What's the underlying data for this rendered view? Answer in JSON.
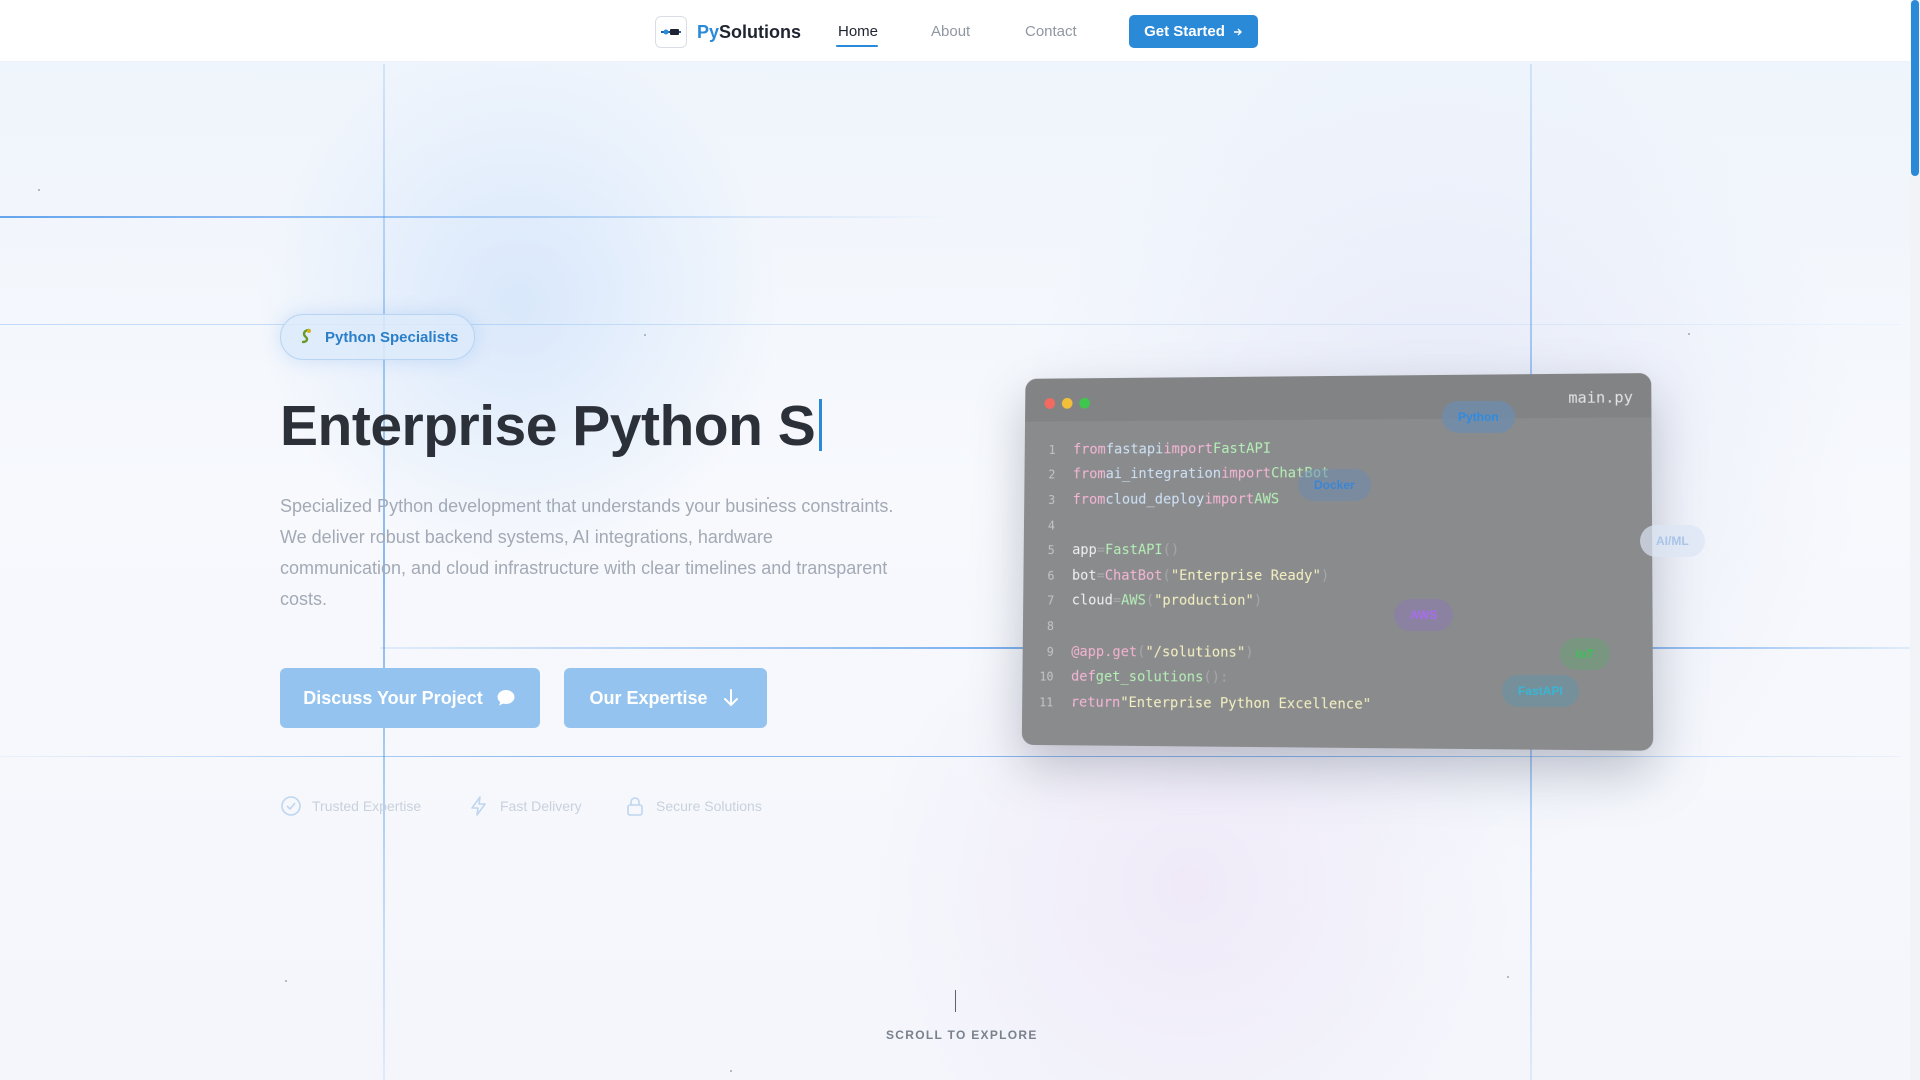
{
  "nav": {
    "brand_prefix": "Py",
    "brand_suffix": "Solutions",
    "links": [
      "Home",
      "About",
      "Contact"
    ],
    "cta_label": "Get Started"
  },
  "hero": {
    "badge": "Python Specialists",
    "title": "Enterprise Python S",
    "description": "Specialized Python development that understands your business constraints. We deliver robust backend systems, AI integrations, hardware communication, and cloud infrastructure with clear timelines and transparent costs.",
    "primary_button": "Discuss Your Project",
    "secondary_button": "Our Expertise",
    "features": [
      "Trusted Expertise",
      "Fast Delivery",
      "Secure Solutions"
    ]
  },
  "code_window": {
    "filename": "main.py",
    "line_numbers": [
      "1",
      "2",
      "3",
      "4",
      "5",
      "6",
      "7",
      "8",
      "9",
      "10",
      "11"
    ],
    "lines": {
      "l1": {
        "kw1": "from",
        "mod": "fastapi",
        "kw2": "import",
        "cls": "FastAPI"
      },
      "l2": {
        "kw1": "from",
        "mod": "ai_integration",
        "kw2": "import",
        "cls": "ChatBot"
      },
      "l3": {
        "kw1": "from",
        "mod": "cloud_deploy",
        "kw2": "import",
        "cls": "AWS"
      },
      "l5": {
        "var": "app",
        "op": "=",
        "cls": "FastAPI",
        "paren": "()"
      },
      "l6": {
        "var": "bot",
        "op": "=",
        "cls": "ChatBot",
        "open": "(",
        "str": "\"Enterprise Ready\"",
        "close": ")"
      },
      "l7": {
        "var": "cloud",
        "op": "=",
        "cls": "AWS",
        "open": "(",
        "str": "\"production\"",
        "close": ")"
      },
      "l9": {
        "dec": "@app.get",
        "open": "(",
        "str": "\"/solutions\"",
        "close": ")"
      },
      "l10": {
        "kw": "def",
        "fn": "get_solutions",
        "paren": "():"
      },
      "l11": {
        "kw": "return",
        "str": "\"Enterprise Python Excellence\""
      }
    }
  },
  "tech_chips": [
    "Python",
    "Docker",
    "AI/ML",
    "AWS",
    "IoT",
    "FastAPI"
  ],
  "scroll_hint": "SCROLL TO EXPLORE",
  "colors": {
    "accent": "#2b8ad8",
    "button_muted": "#93c3ee",
    "code_bg": "#8a8b8d"
  },
  "icons": {
    "logo": "brand-logo-icon",
    "badge": "python-snake-icon",
    "cta": "arrow-right-icon",
    "primary_button": "chat-bubble-icon",
    "secondary_button": "arrow-down-icon",
    "features": [
      "check-circle-icon",
      "lightning-icon",
      "lock-icon"
    ]
  }
}
